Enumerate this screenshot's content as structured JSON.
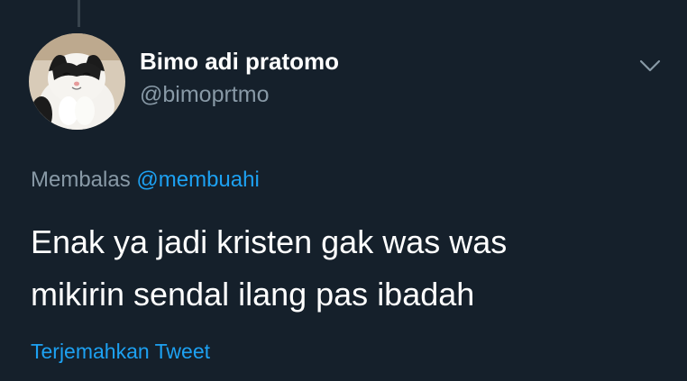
{
  "tweet": {
    "author_name": "Bimo adi pratomo",
    "author_handle": "@bimoprtmo",
    "replying_prefix": "Membalas",
    "replying_to": "@membuahi",
    "text_line_1": "Enak ya jadi kristen gak was was",
    "text_line_2": "mikirin sendal ilang pas ibadah",
    "translate_label": "Terjemahkan Tweet"
  },
  "icons": {
    "menu": "chevron-down-icon",
    "avatar": "cat-avatar"
  },
  "colors": {
    "background": "#15202b",
    "primary_text": "#ffffff",
    "secondary_text": "#8899a6",
    "link": "#1da1f2"
  }
}
